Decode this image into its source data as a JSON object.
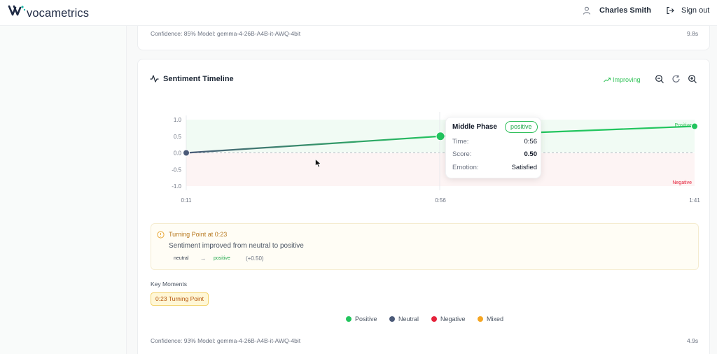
{
  "header": {
    "logo_text": "vocametrics",
    "user_name": "Charles Smith",
    "signout_label": "Sign out"
  },
  "top_card": {
    "meta": "Confidence: 85%  Model: gemma-4-26B-A4B-it-AWQ-4bit",
    "time": "9.8s"
  },
  "timeline": {
    "title": "Sentiment Timeline",
    "trend_label": "Improving",
    "tools": [
      "zoom-out",
      "reset",
      "zoom-in"
    ]
  },
  "chart_data": {
    "type": "line",
    "x": [
      "0:11",
      "0:56",
      "1:41"
    ],
    "values": [
      0.0,
      0.5,
      0.8
    ],
    "ylim": [
      -1.0,
      1.0
    ],
    "yticks": [
      "1.0",
      "0.5",
      "0.0",
      "-0.5",
      "-1.0"
    ],
    "xticks": [
      "0:11",
      "0:56",
      "1:41"
    ],
    "zone_labels": {
      "positive": "Positive",
      "negative": "Negative"
    },
    "point_colors": [
      "#4b5a78",
      "#22c55e",
      "#22c55e"
    ],
    "grid": false
  },
  "tooltip": {
    "title": "Middle Phase",
    "badge": "positive",
    "rows": [
      {
        "k": "Time:",
        "v": "0:56"
      },
      {
        "k": "Score:",
        "v": "0.50"
      },
      {
        "k": "Emotion:",
        "v": "Satisfied"
      }
    ]
  },
  "turning_point": {
    "title": "Turning Point at 0:23",
    "description": "Sentiment improved from neutral to positive",
    "from": "neutral",
    "arrow": "→",
    "to": "positive",
    "delta": "(+0.50)"
  },
  "key_moments": {
    "label": "Key Moments",
    "chip": "0:23  Turning Point"
  },
  "legend": [
    {
      "name": "Positive",
      "color": "#22c55e"
    },
    {
      "name": "Neutral",
      "color": "#4b5a78"
    },
    {
      "name": "Negative",
      "color": "#e5223b"
    },
    {
      "name": "Mixed",
      "color": "#f5a623"
    }
  ],
  "bottom_card": {
    "meta": "Confidence: 93%  Model: gemma-4-26B-A4B-it-AWQ-4bit",
    "time": "4.9s"
  }
}
